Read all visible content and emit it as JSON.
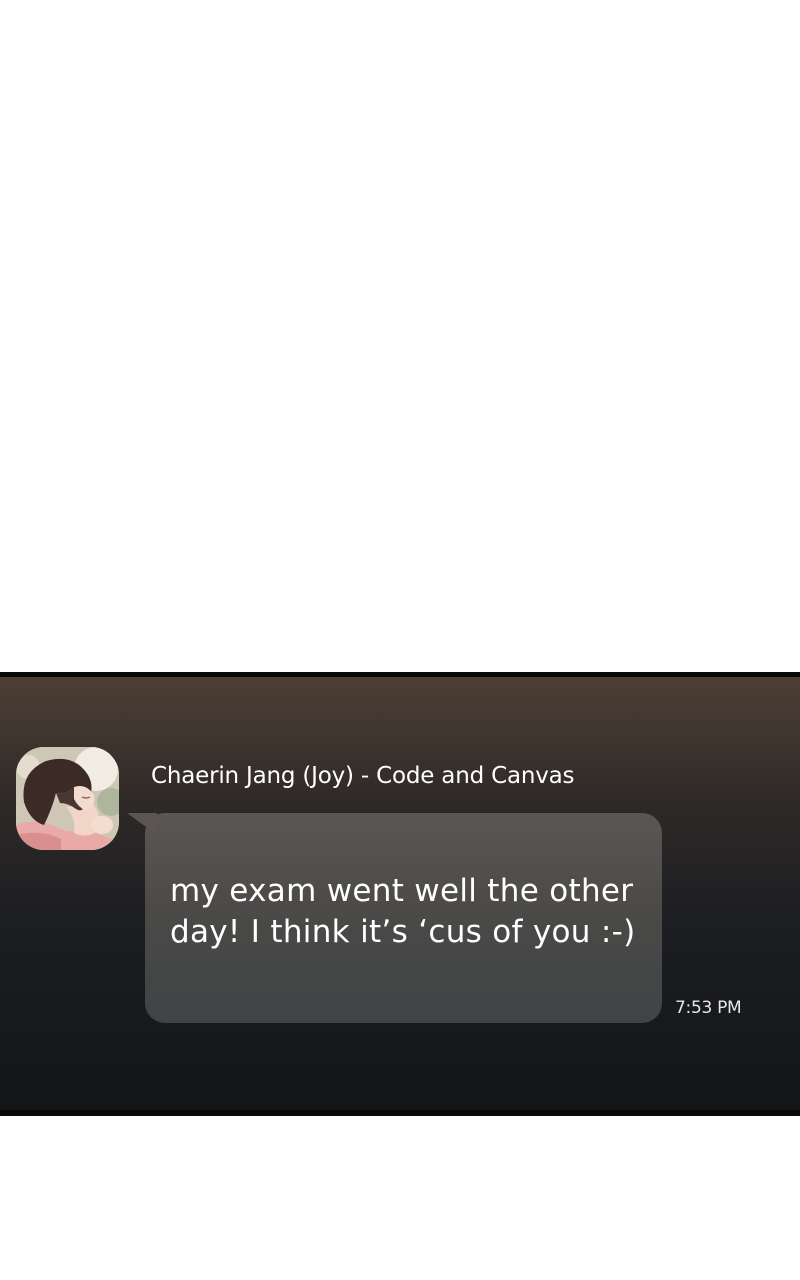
{
  "chat": {
    "sender_name": "Chaerin Jang (Joy) - Code and Canvas",
    "message": "my exam went well the other day! I think it’s ‘cus of you :-)",
    "timestamp": "7:53 PM",
    "avatar_icon": "profile-photo-girl-icon"
  },
  "colors": {
    "panel_top": "#4e3f35",
    "panel_bottom": "#131519",
    "bubble": "#4a4947",
    "text": "#ffffff"
  }
}
